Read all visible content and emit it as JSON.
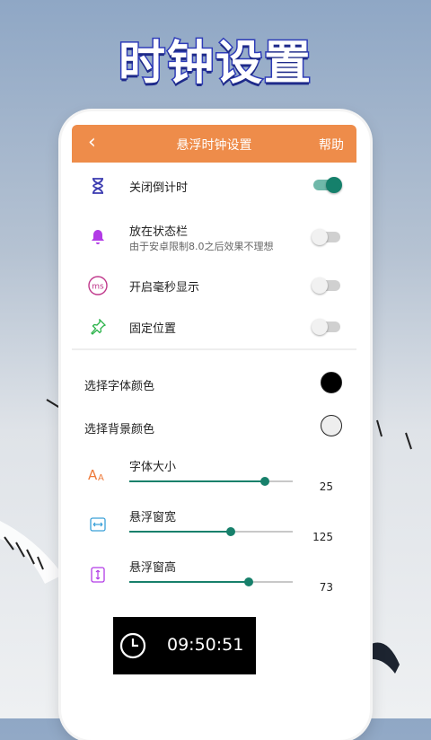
{
  "headline": "时钟设置",
  "header": {
    "back_icon": "chevron-left-icon",
    "title": "悬浮时钟设置",
    "help_label": "帮助",
    "bg_color": "#ee8c4a"
  },
  "toggles": [
    {
      "label": "关闭倒计时",
      "sublabel": "",
      "icon": "hourglass-icon",
      "on": true
    },
    {
      "label": "放在状态栏",
      "sublabel": "由于安卓限制8.0之后效果不理想",
      "icon": "bell-icon",
      "on": false
    },
    {
      "label": "开启毫秒显示",
      "sublabel": "",
      "icon": "ms-icon",
      "on": false
    },
    {
      "label": "固定位置",
      "sublabel": "",
      "icon": "pin-icon",
      "on": false
    }
  ],
  "colors": [
    {
      "label": "选择字体颜色",
      "value": "#000000"
    },
    {
      "label": "选择背景颜色",
      "value": "#eeeeee"
    }
  ],
  "sliders": [
    {
      "label": "字体大小",
      "value": "25",
      "fraction": 0.83,
      "icon": "font-size-icon"
    },
    {
      "label": "悬浮窗宽",
      "value": "125",
      "fraction": 0.62,
      "icon": "width-icon"
    },
    {
      "label": "悬浮窗高",
      "value": "73",
      "fraction": 0.73,
      "icon": "height-icon"
    }
  ],
  "clock_preview": {
    "time": "09:50:51",
    "icon": "clock-icon"
  },
  "accent": "#17806b"
}
